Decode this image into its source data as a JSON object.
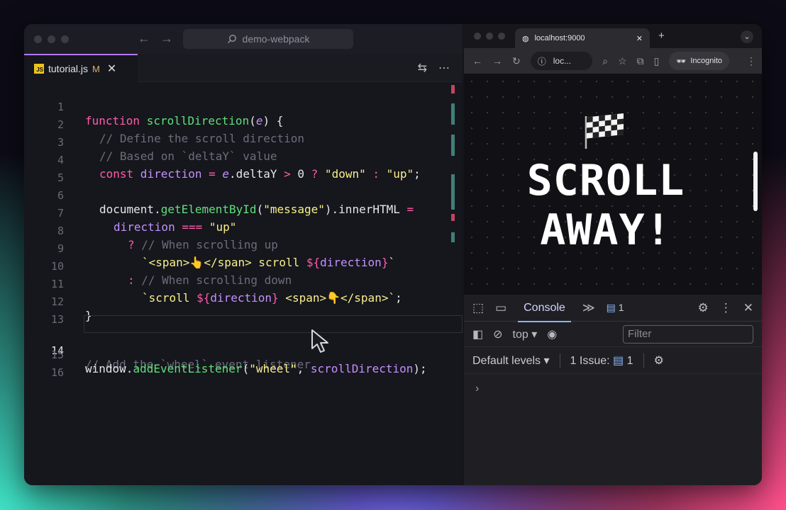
{
  "editor": {
    "search_text": "demo-webpack",
    "tab": {
      "filename": "tutorial.js",
      "status": "M",
      "lang_badge": "JS"
    },
    "lines": [
      {
        "num": "1"
      },
      {
        "num": "2"
      },
      {
        "num": "3"
      },
      {
        "num": "4"
      },
      {
        "num": "5"
      },
      {
        "num": "6"
      },
      {
        "num": "7"
      },
      {
        "num": "8"
      },
      {
        "num": "9"
      },
      {
        "num": "10"
      },
      {
        "num": "11"
      },
      {
        "num": "12"
      },
      {
        "num": "13"
      },
      {
        "num": "14"
      },
      {
        "num": "15"
      },
      {
        "num": "16"
      }
    ],
    "code": {
      "l1_kw": "function",
      "l1_fn": "scrollDirection",
      "l1_open": "(",
      "l1_param": "e",
      "l1_close": ") {",
      "l2": "// Define the scroll direction",
      "l3": "// Based on `deltaY` value",
      "l4_kw": "const",
      "l4_a": " direction ",
      "l4_eq": "=",
      "l4_e": " e",
      "l4_b": ".deltaY ",
      "l4_gt": ">",
      "l4_c": " 0 ",
      "l4_q": "?",
      "l4_s1": " \"down\"",
      "l4_colon": " :",
      "l4_s2": " \"up\"",
      "l4_end": ";",
      "l6_a": "document.",
      "l6_fn": "getElementById",
      "l6_b": "(",
      "l6_s": "\"message\"",
      "l6_c": ").innerHTML ",
      "l6_eq": "=",
      "l7_a": "direction ",
      "l7_op": "===",
      "l7_s": " \"up\"",
      "l8_q": "?",
      "l8_c": " // When scrolling up",
      "l9_t1": "`<span>👆</span> scroll ",
      "l9_i": "${",
      "l9_v": "direction",
      "l9_i2": "}",
      "l9_t2": "`",
      "l10_q": ":",
      "l10_c": " // When scrolling down",
      "l11_t1": "`scroll ",
      "l11_i": "${",
      "l11_v": "direction",
      "l11_i2": "}",
      "l11_t2": " <span>👇</span>`",
      "l11_end": ";",
      "l12": "}",
      "l14": "// Add the `wheel` event listener",
      "l15_a": "window.",
      "l15_fn": "addEventListener",
      "l15_b": "(",
      "l15_s": "\"wheel\"",
      "l15_c": ", ",
      "l15_v": "scrollDirection",
      "l15_d": ");"
    }
  },
  "browser": {
    "tab_title": "localhost:9000",
    "address": "loc...",
    "incognito_label": "Incognito",
    "headline_line1": "SCROLL",
    "headline_line2": "AWAY!"
  },
  "devtools": {
    "console_tab": "Console",
    "more_tabs": "≫",
    "issues_count": "1",
    "context": "top",
    "filter_placeholder": "Filter",
    "levels": "Default levels",
    "issues_label": "1 Issue:",
    "issues_badge_count": "1",
    "prompt": "›"
  },
  "colors": {
    "accent_purple": "#b476ff",
    "keyword": "#ff5ca8",
    "function": "#5fe07a",
    "string": "#f8f08a",
    "comment": "#6d6d7c",
    "link_blue": "#8ab4f8"
  }
}
